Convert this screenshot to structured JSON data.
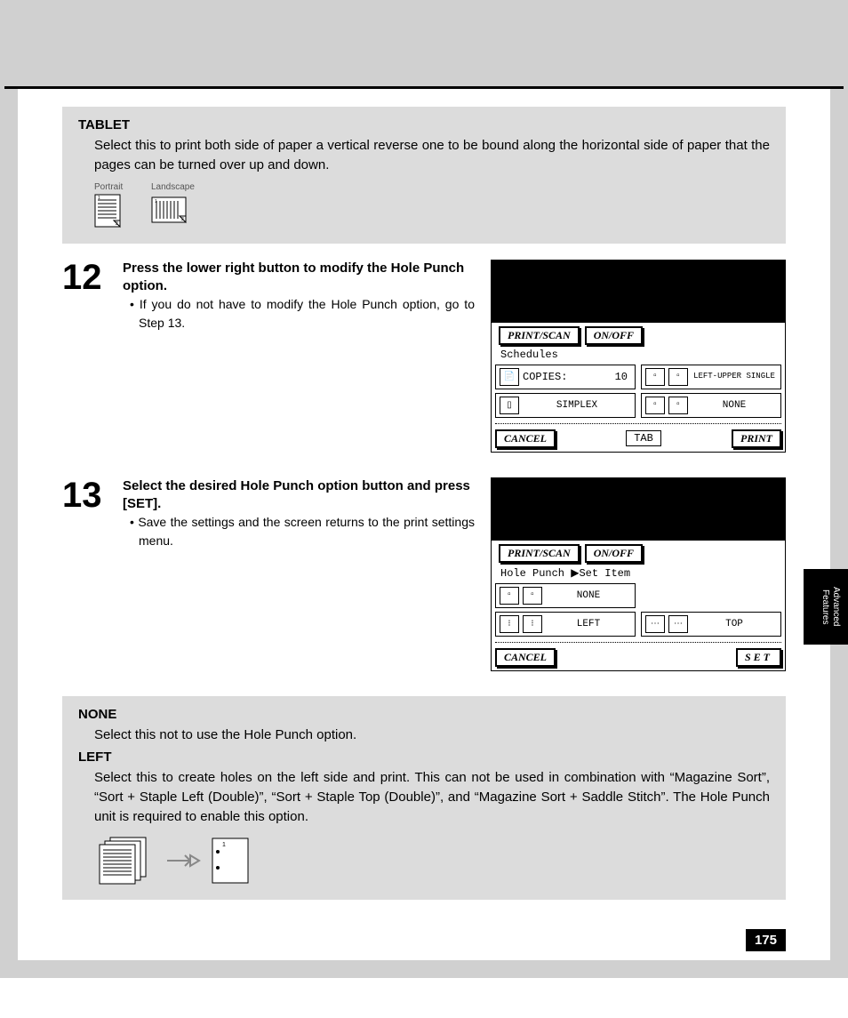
{
  "tablet": {
    "heading": "TABLET",
    "body": "Select this to print both side of paper a vertical reverse one to be bound along the horizontal side of paper that the pages can be turned over up and down.",
    "portrait": "Portrait",
    "landscape": "Landscape"
  },
  "step12": {
    "num": "12",
    "title": "Press the lower right button to modify the Hole Punch option.",
    "bullet": "If you do not have to modify the Hole Punch option, go to Step 13."
  },
  "step13": {
    "num": "13",
    "title": "Select the desired Hole Punch option button and press [SET].",
    "bullet": "Save the settings and the screen returns to the print settings menu."
  },
  "screen1": {
    "btn1": "PRINT/SCAN",
    "btn2": "ON/OFF",
    "subtitle": "Schedules",
    "copies_label": "COPIES:",
    "copies_val": "10",
    "staple": "LEFT-UPPER SINGLE",
    "duplex": "SIMPLEX",
    "punch": "NONE",
    "cancel": "CANCEL",
    "tab": "TAB",
    "print": "PRINT"
  },
  "screen2": {
    "btn1": "PRINT/SCAN",
    "btn2": "ON/OFF",
    "subtitle": "Hole Punch      ▶Set Item",
    "none": "NONE",
    "left": "LEFT",
    "top": "TOP",
    "cancel": "CANCEL",
    "set": "SET"
  },
  "bottom": {
    "none_h": "NONE",
    "none_b": "Select this not to use the Hole Punch option.",
    "left_h": "LEFT",
    "left_b": "Select this to create holes on the left side and print.  This can not be used in combination with “Magazine Sort”, “Sort + Staple Left (Double)”, “Sort + Staple Top (Double)”, and “Magazine Sort + Saddle Stitch”.  The Hole Punch unit is required to enable this option."
  },
  "sidetab": "Advanced Features",
  "pagenum": "175"
}
